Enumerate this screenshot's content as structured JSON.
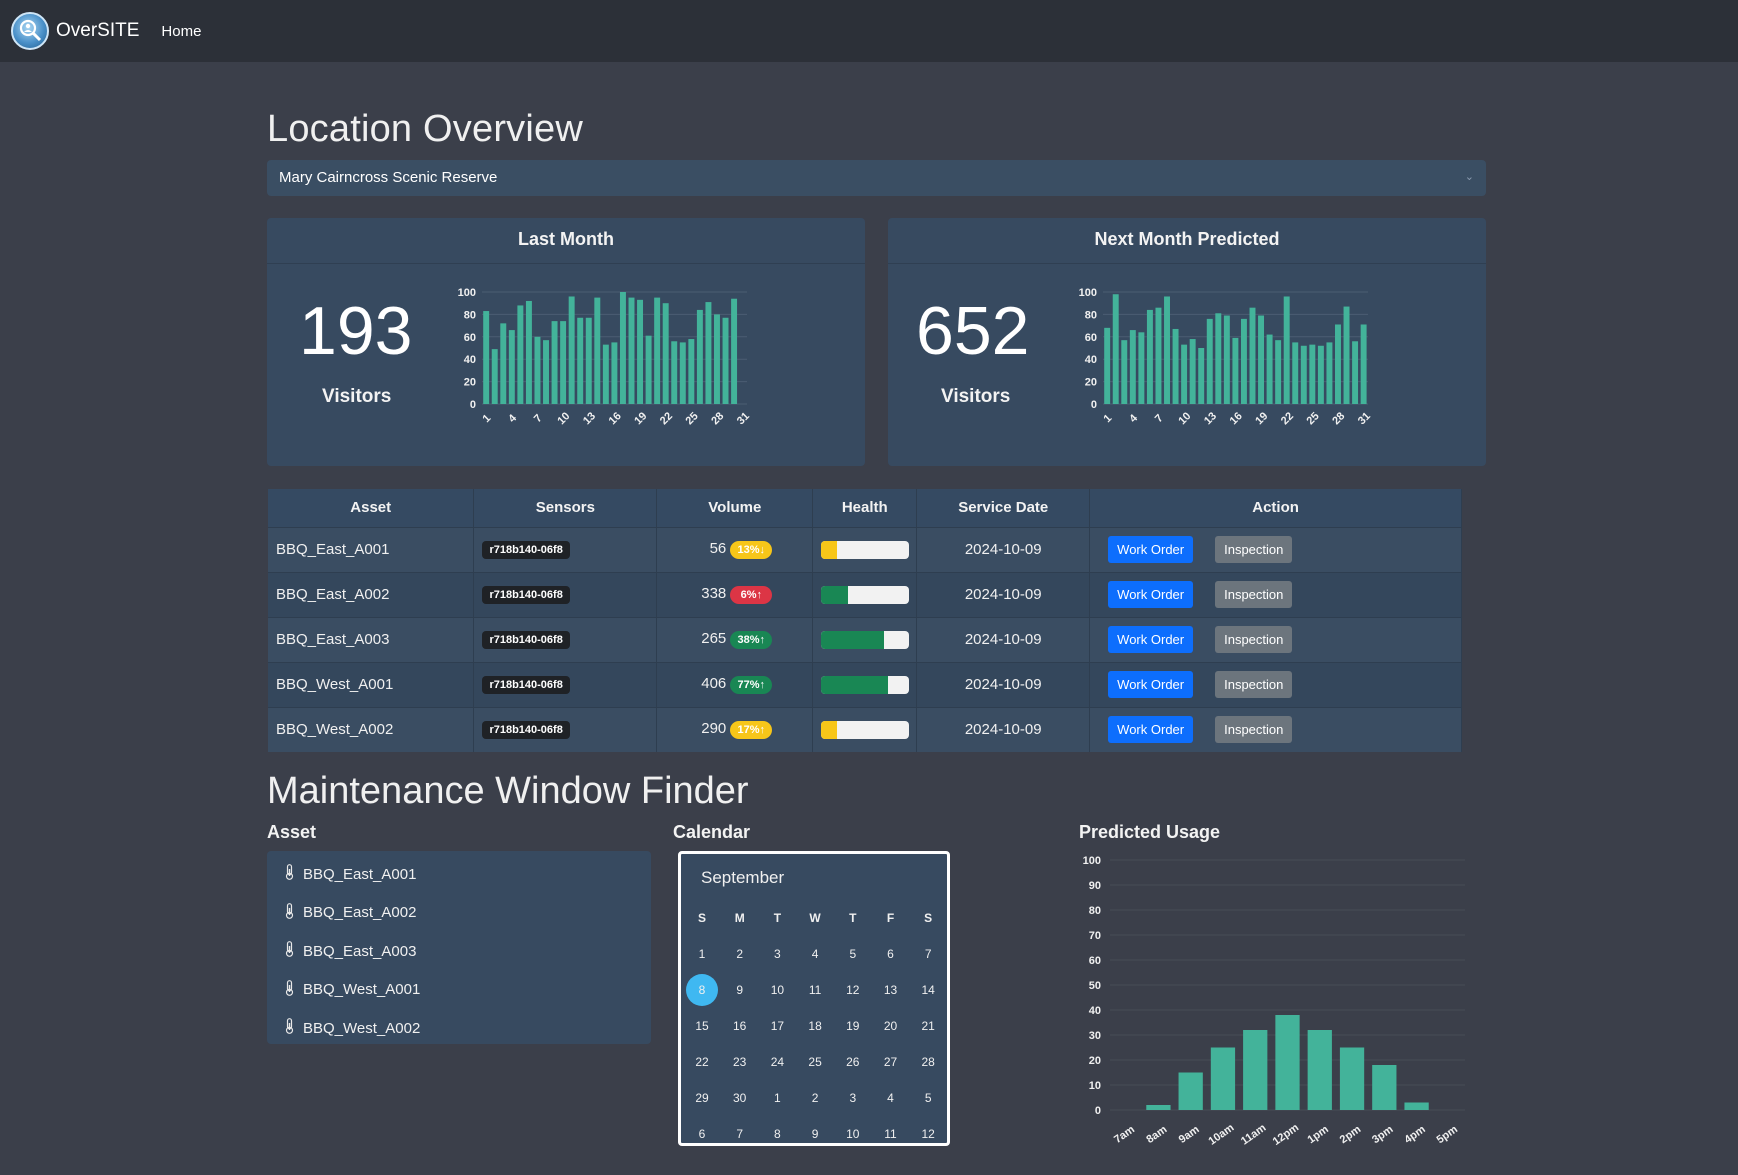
{
  "navbar": {
    "brand": "OverSITE",
    "home": "Home"
  },
  "page_title": "Location Overview",
  "location": {
    "selected": "Mary Cairncross Scenic Reserve"
  },
  "last_month": {
    "title": "Last Month",
    "value": "193",
    "label": "Visitors"
  },
  "next_month": {
    "title": "Next Month Predicted",
    "value": "652",
    "label": "Visitors"
  },
  "table": {
    "headers": [
      "Asset",
      "Sensors",
      "Volume",
      "Health",
      "Service Date",
      "Action"
    ],
    "rows": [
      {
        "asset": "BBQ_East_A001",
        "sensor": "r718b140-06f8",
        "volume": "56",
        "pct": "13%↓",
        "pct_color": "#f7c619",
        "pct_text_color": "#ffffff",
        "health": 0.18,
        "health_color": "#f7c619",
        "date": "2024-10-09",
        "wo": "Work Order",
        "insp": "Inspection"
      },
      {
        "asset": "BBQ_East_A002",
        "sensor": "r718b140-06f8",
        "volume": "338",
        "pct": "6%↑",
        "pct_color": "#dc3545",
        "pct_text_color": "#ffffff",
        "health": 0.31,
        "health_color": "#198754",
        "date": "2024-10-09",
        "wo": "Work Order",
        "insp": "Inspection"
      },
      {
        "asset": "BBQ_East_A003",
        "sensor": "r718b140-06f8",
        "volume": "265",
        "pct": "38%↑",
        "pct_color": "#198754",
        "pct_text_color": "#ffffff",
        "health": 0.72,
        "health_color": "#198754",
        "date": "2024-10-09",
        "wo": "Work Order",
        "insp": "Inspection"
      },
      {
        "asset": "BBQ_West_A001",
        "sensor": "r718b140-06f8",
        "volume": "406",
        "pct": "77%↑",
        "pct_color": "#198754",
        "pct_text_color": "#ffffff",
        "health": 0.76,
        "health_color": "#198754",
        "date": "2024-10-09",
        "wo": "Work Order",
        "insp": "Inspection"
      },
      {
        "asset": "BBQ_West_A002",
        "sensor": "r718b140-06f8",
        "volume": "290",
        "pct": "17%↑",
        "pct_color": "#f7c619",
        "pct_text_color": "#ffffff",
        "health": 0.18,
        "health_color": "#f7c619",
        "date": "2024-10-09",
        "wo": "Work Order",
        "insp": "Inspection"
      }
    ]
  },
  "maintenance": {
    "title": "Maintenance Window Finder",
    "asset_heading": "Asset",
    "calendar_heading": "Calendar",
    "usage_heading": "Predicted Usage",
    "assets": [
      "BBQ_East_A001",
      "BBQ_East_A002",
      "BBQ_East_A003",
      "BBQ_West_A001",
      "BBQ_West_A002"
    ],
    "calendar": {
      "month": "September",
      "dow": [
        "S",
        "M",
        "T",
        "W",
        "T",
        "F",
        "S"
      ],
      "weeks": [
        [
          "1",
          "2",
          "3",
          "4",
          "5",
          "6",
          "7"
        ],
        [
          "8",
          "9",
          "10",
          "11",
          "12",
          "13",
          "14"
        ],
        [
          "15",
          "16",
          "17",
          "18",
          "19",
          "20",
          "21"
        ],
        [
          "22",
          "23",
          "24",
          "25",
          "26",
          "27",
          "28"
        ],
        [
          "29",
          "30",
          "1",
          "2",
          "3",
          "4",
          "5"
        ],
        [
          "6",
          "7",
          "8",
          "9",
          "10",
          "11",
          "12"
        ]
      ],
      "selected": "8"
    }
  },
  "colors": {
    "bar": "#43b39a",
    "selected_day": "#3fb8f1",
    "work_order": "#0d6efd",
    "inspection": "#6c757d"
  },
  "chart_data": [
    {
      "type": "bar",
      "x": [
        1,
        2,
        3,
        4,
        5,
        6,
        7,
        8,
        9,
        10,
        11,
        12,
        13,
        14,
        15,
        16,
        17,
        18,
        19,
        20,
        21,
        22,
        23,
        24,
        25,
        26,
        27,
        28,
        29,
        30,
        31
      ],
      "xticks": [
        "1",
        "4",
        "7",
        "10",
        "13",
        "16",
        "19",
        "22",
        "25",
        "28",
        "31"
      ],
      "values": [
        83,
        49,
        72,
        66,
        88,
        92,
        60,
        57,
        74,
        74,
        96,
        77,
        77,
        95,
        53,
        55,
        100,
        95,
        93,
        61,
        95,
        90,
        56,
        55,
        58,
        84,
        91,
        80,
        77,
        94
      ],
      "ylim": [
        0,
        100
      ],
      "yticks": [
        "0",
        "20",
        "40",
        "60",
        "80",
        "100"
      ]
    },
    {
      "type": "bar",
      "x": [
        1,
        2,
        3,
        4,
        5,
        6,
        7,
        8,
        9,
        10,
        11,
        12,
        13,
        14,
        15,
        16,
        17,
        18,
        19,
        20,
        21,
        22,
        23,
        24,
        25,
        26,
        27,
        28,
        29,
        30,
        31
      ],
      "xticks": [
        "1",
        "4",
        "7",
        "10",
        "13",
        "16",
        "19",
        "22",
        "25",
        "28",
        "31"
      ],
      "values": [
        68,
        98,
        57,
        66,
        64,
        84,
        86,
        96,
        67,
        53,
        58,
        50,
        76,
        81,
        79,
        59,
        76,
        86,
        79,
        62,
        57,
        96,
        55,
        52,
        53,
        52,
        55,
        71,
        87,
        56,
        71
      ],
      "ylim": [
        0,
        100
      ],
      "yticks": [
        "0",
        "20",
        "40",
        "60",
        "80",
        "100"
      ]
    },
    {
      "type": "bar",
      "categories": [
        "7am",
        "8am",
        "9am",
        "10am",
        "11am",
        "12pm",
        "1pm",
        "2pm",
        "3pm",
        "4pm",
        "5pm"
      ],
      "values": [
        0,
        2,
        15,
        25,
        32,
        38,
        32,
        25,
        18,
        3,
        0
      ],
      "ylim": [
        0,
        100
      ],
      "yticks": [
        "0",
        "10",
        "20",
        "30",
        "40",
        "50",
        "60",
        "70",
        "80",
        "90",
        "100"
      ]
    }
  ]
}
